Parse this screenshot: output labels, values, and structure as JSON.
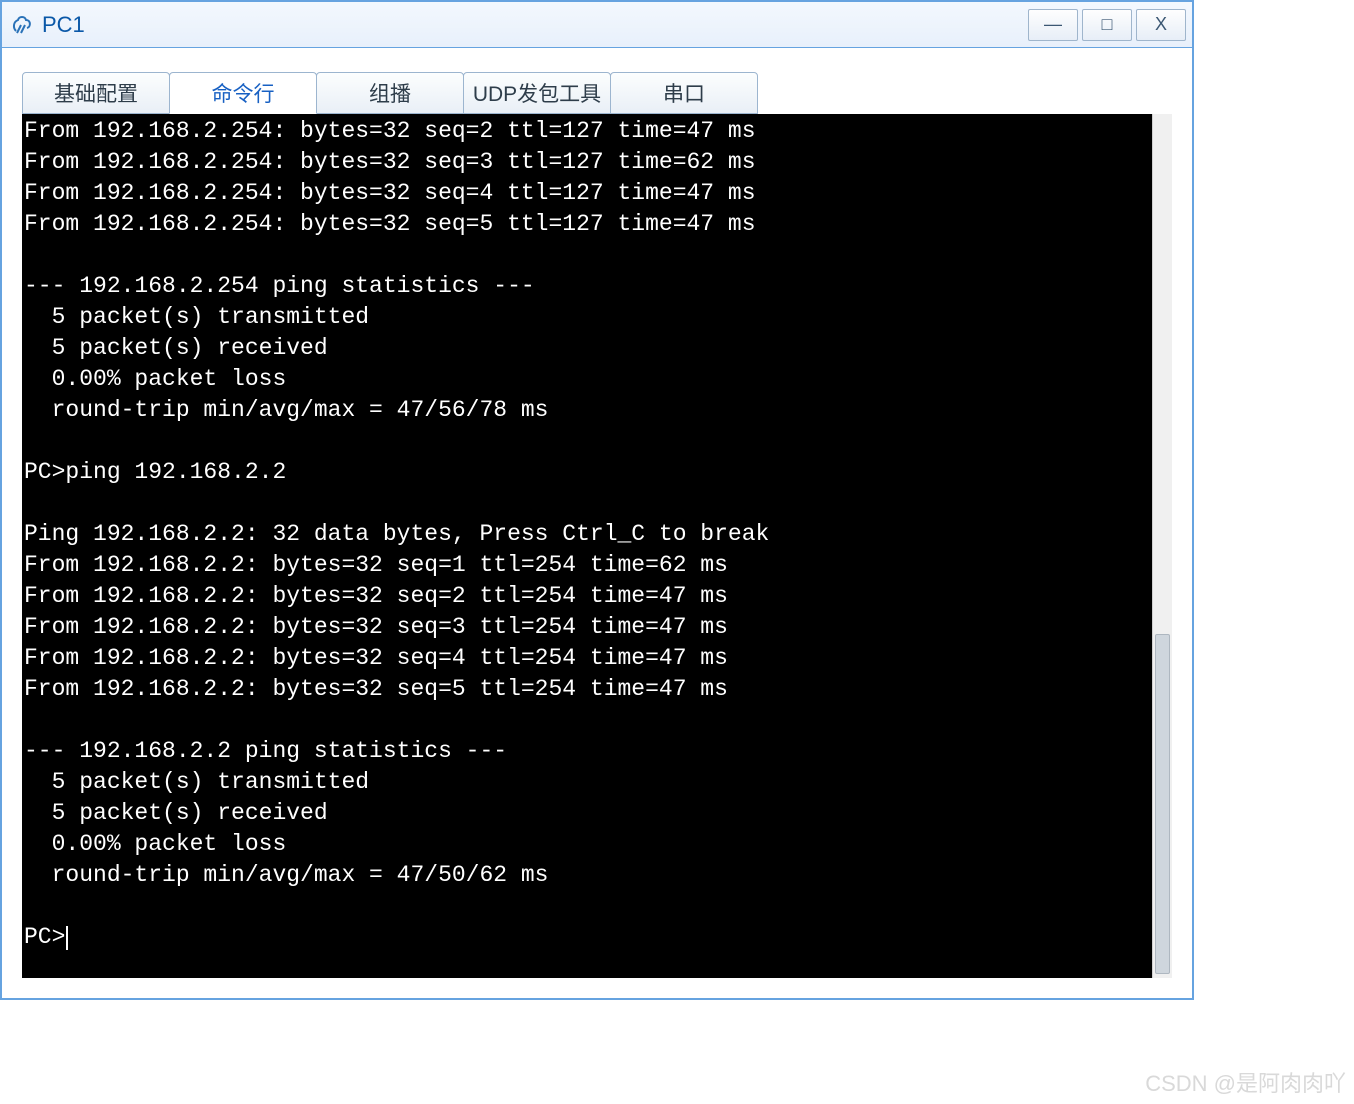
{
  "window": {
    "title": "PC1",
    "controls": {
      "min": "—",
      "max": "□",
      "close": "X"
    }
  },
  "tabs": [
    {
      "label": "基础配置",
      "active": false
    },
    {
      "label": "命令行",
      "active": true
    },
    {
      "label": "组播",
      "active": false
    },
    {
      "label": "UDP发包工具",
      "active": false
    },
    {
      "label": "串口",
      "active": false
    }
  ],
  "terminal_lines": [
    "From 192.168.2.254: bytes=32 seq=2 ttl=127 time=47 ms",
    "From 192.168.2.254: bytes=32 seq=3 ttl=127 time=62 ms",
    "From 192.168.2.254: bytes=32 seq=4 ttl=127 time=47 ms",
    "From 192.168.2.254: bytes=32 seq=5 ttl=127 time=47 ms",
    "",
    "--- 192.168.2.254 ping statistics ---",
    "  5 packet(s) transmitted",
    "  5 packet(s) received",
    "  0.00% packet loss",
    "  round-trip min/avg/max = 47/56/78 ms",
    "",
    "PC>ping 192.168.2.2",
    "",
    "Ping 192.168.2.2: 32 data bytes, Press Ctrl_C to break",
    "From 192.168.2.2: bytes=32 seq=1 ttl=254 time=62 ms",
    "From 192.168.2.2: bytes=32 seq=2 ttl=254 time=47 ms",
    "From 192.168.2.2: bytes=32 seq=3 ttl=254 time=47 ms",
    "From 192.168.2.2: bytes=32 seq=4 ttl=254 time=47 ms",
    "From 192.168.2.2: bytes=32 seq=5 ttl=254 time=47 ms",
    "",
    "--- 192.168.2.2 ping statistics ---",
    "  5 packet(s) transmitted",
    "  5 packet(s) received",
    "  0.00% packet loss",
    "  round-trip min/avg/max = 47/50/62 ms",
    ""
  ],
  "prompt": "PC>",
  "watermark": "CSDN @是阿肉肉吖"
}
